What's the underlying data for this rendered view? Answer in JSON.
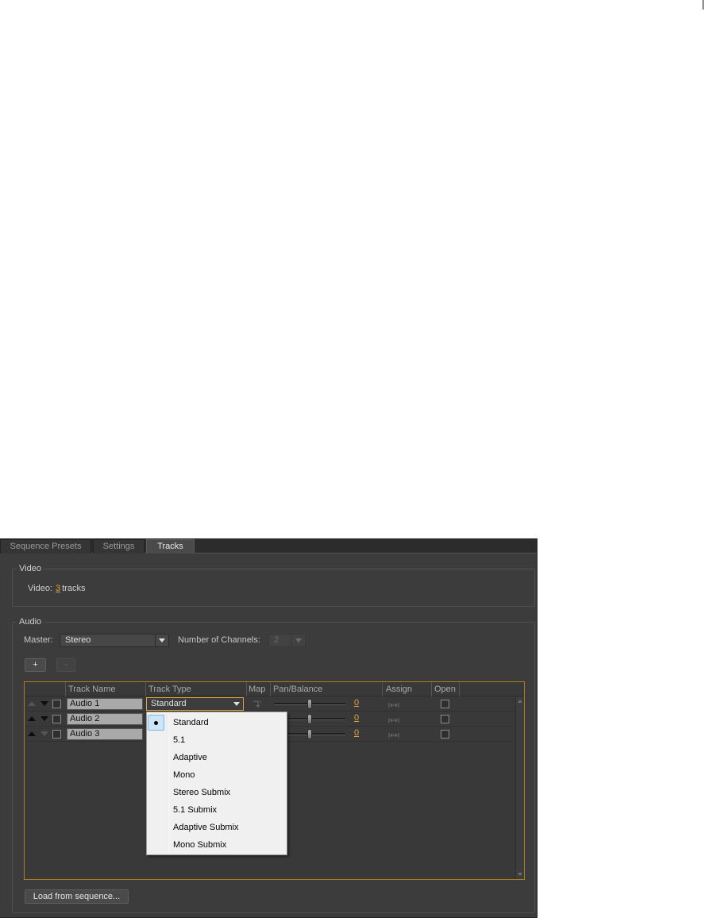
{
  "tabs": [
    {
      "label": "Sequence Presets",
      "active": false
    },
    {
      "label": "Settings",
      "active": false
    },
    {
      "label": "Tracks",
      "active": true
    }
  ],
  "video": {
    "group_label": "Video",
    "field_label": "Video:",
    "track_count": "3",
    "unit": "tracks"
  },
  "audio": {
    "group_label": "Audio",
    "master_label": "Master:",
    "master_value": "Stereo",
    "channels_label": "Number of Channels:",
    "channels_value": "2",
    "add_button": "+",
    "remove_button": "-",
    "columns": {
      "track_name": "Track Name",
      "track_type": "Track Type",
      "map": "Map",
      "pan_balance": "Pan/Balance",
      "assign": "Assign",
      "open": "Open"
    },
    "tracks": [
      {
        "name": "Audio 1",
        "type": "Standard",
        "pan": 0,
        "move_up_enabled": false,
        "move_down_enabled": true,
        "open": false
      },
      {
        "name": "Audio 2",
        "pan": 0,
        "move_up_enabled": true,
        "move_down_enabled": true,
        "open": false
      },
      {
        "name": "Audio 3",
        "pan": 0,
        "move_up_enabled": true,
        "move_down_enabled": false,
        "open": false
      }
    ],
    "track_type_menu": {
      "options": [
        "Standard",
        "5.1",
        "Adaptive",
        "Mono",
        "Stereo Submix",
        "5.1 Submix",
        "Adaptive Submix",
        "Mono Submix"
      ],
      "selected_index": 0
    },
    "load_button": "Load from sequence..."
  },
  "icons": {
    "move_up": "triangle-up-icon",
    "move_down": "triangle-down-icon",
    "dropdown": "chevron-down-icon",
    "map": "channel-map-icon",
    "assign": "assign-icon",
    "selected_option": "bullet-icon"
  },
  "colors": {
    "accent": "#e8a33d",
    "table_border": "#b07d24",
    "menu_selection": "#cde6f7"
  }
}
